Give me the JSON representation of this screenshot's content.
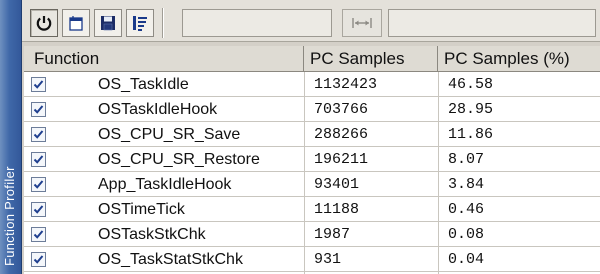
{
  "panel": {
    "title": "Function Profiler"
  },
  "toolbar": {
    "buttons": [
      {
        "icon": "power-icon",
        "pressed": true
      },
      {
        "icon": "document-icon",
        "pressed": false
      },
      {
        "icon": "save-icon",
        "pressed": false
      },
      {
        "icon": "list-lines-icon",
        "pressed": false
      }
    ],
    "fit_button_icon": "fit-width-icon"
  },
  "table": {
    "columns": [
      "Function",
      "PC Samples",
      "PC Samples (%)"
    ],
    "rows": [
      {
        "checked": true,
        "function": "OS_TaskIdle",
        "pc_samples": "1132423",
        "pc_percent": "46.58"
      },
      {
        "checked": true,
        "function": "OSTaskIdleHook",
        "pc_samples": "703766",
        "pc_percent": "28.95"
      },
      {
        "checked": true,
        "function": "OS_CPU_SR_Save",
        "pc_samples": "288266",
        "pc_percent": "11.86"
      },
      {
        "checked": true,
        "function": "OS_CPU_SR_Restore",
        "pc_samples": "196211",
        "pc_percent": "8.07"
      },
      {
        "checked": true,
        "function": "App_TaskIdleHook",
        "pc_samples": "93401",
        "pc_percent": "3.84"
      },
      {
        "checked": true,
        "function": "OSTimeTick",
        "pc_samples": "11188",
        "pc_percent": "0.46"
      },
      {
        "checked": true,
        "function": "OSTaskStkChk",
        "pc_samples": "1987",
        "pc_percent": "0.08"
      },
      {
        "checked": true,
        "function": "OS_TaskStatStkChk",
        "pc_samples": "931",
        "pc_percent": "0.04"
      }
    ]
  },
  "colors": {
    "panel_accent": "#3f68a8",
    "checkmark": "#1f3f8f"
  }
}
